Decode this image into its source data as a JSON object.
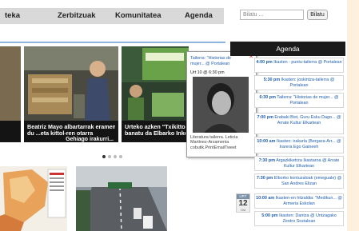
{
  "nav": {
    "items": [
      "teka",
      "Zerbitzuak",
      "Komunitatea",
      "Agenda"
    ]
  },
  "search": {
    "placeholder": "Bilatu ...",
    "button": "Bilatu"
  },
  "slides": [
    {
      "caption_1": "Beatriz Mayo albartarrak eramen",
      "caption_2": "du ...eta kittol-ren otarra",
      "more": "Gehiago irakurri..."
    },
    {
      "caption_1": "Urteko azken \"Txikitto\" dan",
      "caption_2": "banatu da Elbarko Inkest"
    }
  ],
  "tooltip": {
    "title": "Tailerra: \"Historias de mujer... @ Portalean",
    "datetime": "Urt 10 @ 6:30 pm",
    "description": "Literatura tailerra. Leticia Martinez-Arzamenia cobutik.PrintEmailTweet"
  },
  "agenda": {
    "title": "Agenda",
    "date": {
      "month": "URT",
      "day": "12",
      "weekday": "Ost"
    },
    "items": [
      {
        "time": "4:00 pm",
        "text": "Ikasten - puntu-tailerra @ Portalean"
      },
      {
        "time": "5:30 pm",
        "text": "Ikasten: joskintza-tailerra @ Portalean"
      },
      {
        "time": "6:30 pm",
        "text": "Tailerra: \"Historias de mujer... @ Portalean"
      },
      {
        "time": "7:00 pm",
        "text": "Erabaki Bist, Guru Esku Dago... @ Arrate Kultur Elkartean"
      },
      {
        "time": "10:00 am",
        "text": "Ikasten: irakurla (Bergara-Arr... @ Irarera Ego Gaineeh"
      },
      {
        "time": "7:30 pm",
        "text": "Argazkiketrza Ikastaroa @ Arrate Kultur Elkartean"
      },
      {
        "time": "7:30 pm",
        "text": "Elborko kontuzaloak (emeguale) @ San Andres Elizan"
      },
      {
        "time": "10:00 am",
        "text": "Ikasten-en hitzaldia: \"Medikun... @ Armeria Eskolan"
      },
      {
        "time": "5:00 pm",
        "text": "Ikasten: Dantza @ Untzagako Zentro Sozialean"
      }
    ]
  }
}
